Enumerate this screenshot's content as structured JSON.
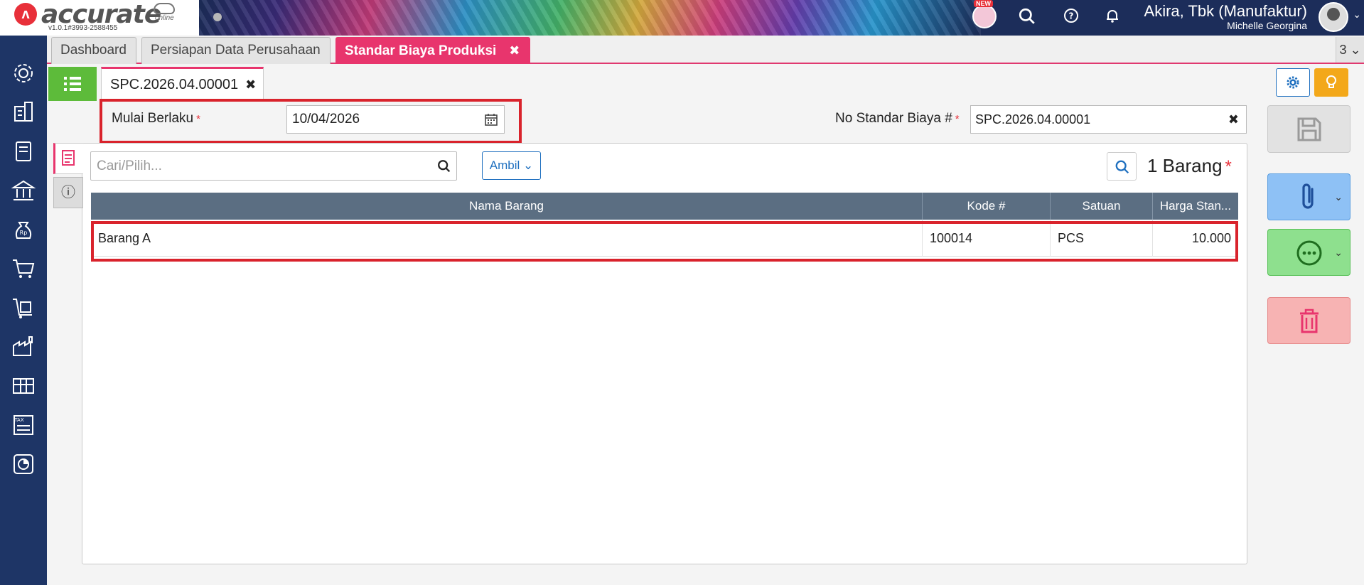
{
  "header": {
    "logo_text": "accurate",
    "logo_sub": "online",
    "version": "v1.0.1#3993-2588455",
    "new_badge": "NEW",
    "company": "Akira, Tbk (Manufaktur)",
    "user": "Michelle Georgina"
  },
  "tabs": [
    {
      "label": "Dashboard"
    },
    {
      "label": "Persiapan Data Perusahaan"
    },
    {
      "label": "Standar Biaya Produksi",
      "close": "✖"
    }
  ],
  "tab_count": "3 ⌄",
  "doc_tab": {
    "label": "SPC.2026.04.00001",
    "close": "✖"
  },
  "form": {
    "mulai_label": "Mulai Berlaku",
    "required_mark": "*",
    "mulai_value": "10/04/2026",
    "nsb_label": "No Standar Biaya #",
    "nsb_value": "SPC.2026.04.00001",
    "nsb_clear": "✖"
  },
  "items_panel": {
    "search_placeholder": "Cari/Pilih...",
    "ambil_label": "Ambil",
    "count_label": "1 Barang"
  },
  "table": {
    "columns": [
      "Nama Barang",
      "Kode #",
      "Satuan",
      "Harga Stan..."
    ],
    "rows": [
      {
        "nama": "Barang A",
        "kode": "100014",
        "satuan": "PCS",
        "harga": "10.000"
      }
    ]
  },
  "colors": {
    "accent": "#e8356d",
    "sidebar": "#1e3566",
    "table_header": "#5b6e82",
    "highlight_box": "#d9232c"
  }
}
